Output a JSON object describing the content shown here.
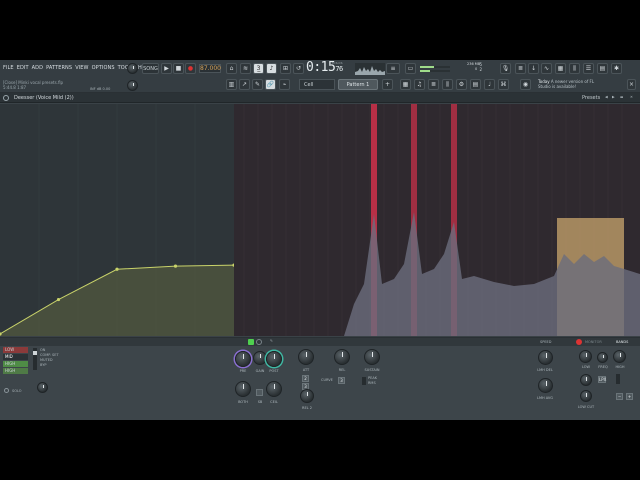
{
  "menu": [
    "FILE",
    "EDIT",
    "ADD",
    "PATTERNS",
    "VIEW",
    "OPTIONS",
    "TOOLS",
    "HELP"
  ],
  "hint": {
    "line1": "[Close] Minki vocal presets.flp",
    "line2": "5:44.8   1:87",
    "infob": "INF dB  0.00"
  },
  "transport": {
    "song_mode": "SONG",
    "bpm": "87.000",
    "time_main": "0:15",
    "time_frac": "76",
    "time_label": "M:S:CS"
  },
  "cpu": {
    "line1": "5",
    "line2": "2",
    "mb": "236 MB",
    "line4": "0"
  },
  "news": {
    "title": "Today",
    "body": "A newer version of FL Studio is available!"
  },
  "snap": "Cell",
  "pattern": "Pattern 1",
  "plugin": {
    "title": "Deesser (Voice Mild (2))",
    "presets": "Presets"
  },
  "curve_graph": {
    "points": [
      [
        0.0,
        0.0
      ],
      [
        0.25,
        0.33
      ],
      [
        0.5,
        0.62
      ],
      [
        0.75,
        0.65
      ],
      [
        1.0,
        0.66
      ]
    ],
    "color": "#c9d36a"
  },
  "spectrum": {
    "peaks_color": "#d0304a",
    "band_highlight_color": "#c9a66e",
    "bars": [
      0.12,
      0.3,
      0.45,
      0.42,
      0.55,
      0.52,
      0.48,
      0.5,
      0.44,
      0.4,
      0.38,
      0.35,
      0.34,
      0.32,
      0.3,
      0.28
    ]
  },
  "bands": {
    "low": "LOW",
    "mid": "MID",
    "high": "HIGH",
    "hi2": "HIGH",
    "pres": "PRESEN"
  },
  "band_options": [
    "ON",
    "COMP. SET",
    "MUTED",
    "BYP"
  ],
  "solo": "SOLO",
  "knobs_mid": [
    {
      "label": "PRE",
      "color": "purple"
    },
    {
      "label": "GAIN",
      "color": "none"
    },
    {
      "label": "POST",
      "color": "teal"
    },
    {
      "label": "BOTH",
      "color": "none"
    },
    {
      "label": "SB",
      "color": "none"
    },
    {
      "label": "CEIL",
      "color": "none"
    }
  ],
  "knobs_right_group": [
    {
      "label": "ATT",
      "val": "2"
    },
    {
      "label": "REL",
      "val": "3"
    },
    {
      "label": "SUSTAIN",
      "val": ""
    }
  ],
  "curve_label": "CURVE",
  "peak_rms": [
    "PEAK",
    "RMS"
  ],
  "rel2": "REL 2",
  "speed": "SPEED",
  "monitor": "MONITOR",
  "bands_label": "BANDS",
  "limit_labels": [
    "LMH DEL",
    "LMH AVG"
  ],
  "eq_labels": [
    "LOW",
    "FREQ",
    "HIGH",
    "LOW CUT"
  ],
  "lp_label": "LPX"
}
